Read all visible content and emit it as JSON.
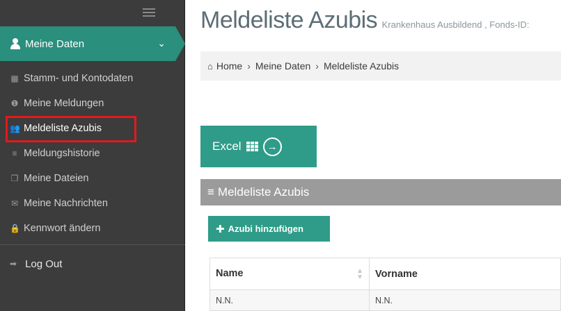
{
  "sidebar": {
    "active_section": "Meine Daten",
    "items": [
      {
        "icon": "calendar-icon",
        "label": "Stamm- und Kontodaten"
      },
      {
        "icon": "info-icon",
        "label": "Meine Meldungen"
      },
      {
        "icon": "users-icon",
        "label": "Meldeliste Azubis"
      },
      {
        "icon": "list-icon",
        "label": "Meldungshistorie"
      },
      {
        "icon": "files-icon",
        "label": "Meine Dateien"
      },
      {
        "icon": "envelope-icon",
        "label": "Meine Nachrichten"
      },
      {
        "icon": "lock-icon",
        "label": "Kennwort ändern"
      }
    ],
    "logout": "Log Out"
  },
  "page": {
    "title": "Meldeliste Azubis",
    "subtitle": "Krankenhaus Ausbildend , Fonds-ID:"
  },
  "breadcrumb": [
    "Home",
    "Meine Daten",
    "Meldeliste Azubis"
  ],
  "excel_button": "Excel",
  "panel": {
    "title": "Meldeliste Azubis",
    "add_button": "Azubi hinzufügen"
  },
  "table": {
    "columns": [
      "Name",
      "Vorname"
    ],
    "rows": [
      [
        "N.N.",
        "N.N."
      ]
    ]
  },
  "colors": {
    "accent": "#2e9c88",
    "sidebar": "#3c3c3c",
    "highlight": "#e3191c"
  }
}
